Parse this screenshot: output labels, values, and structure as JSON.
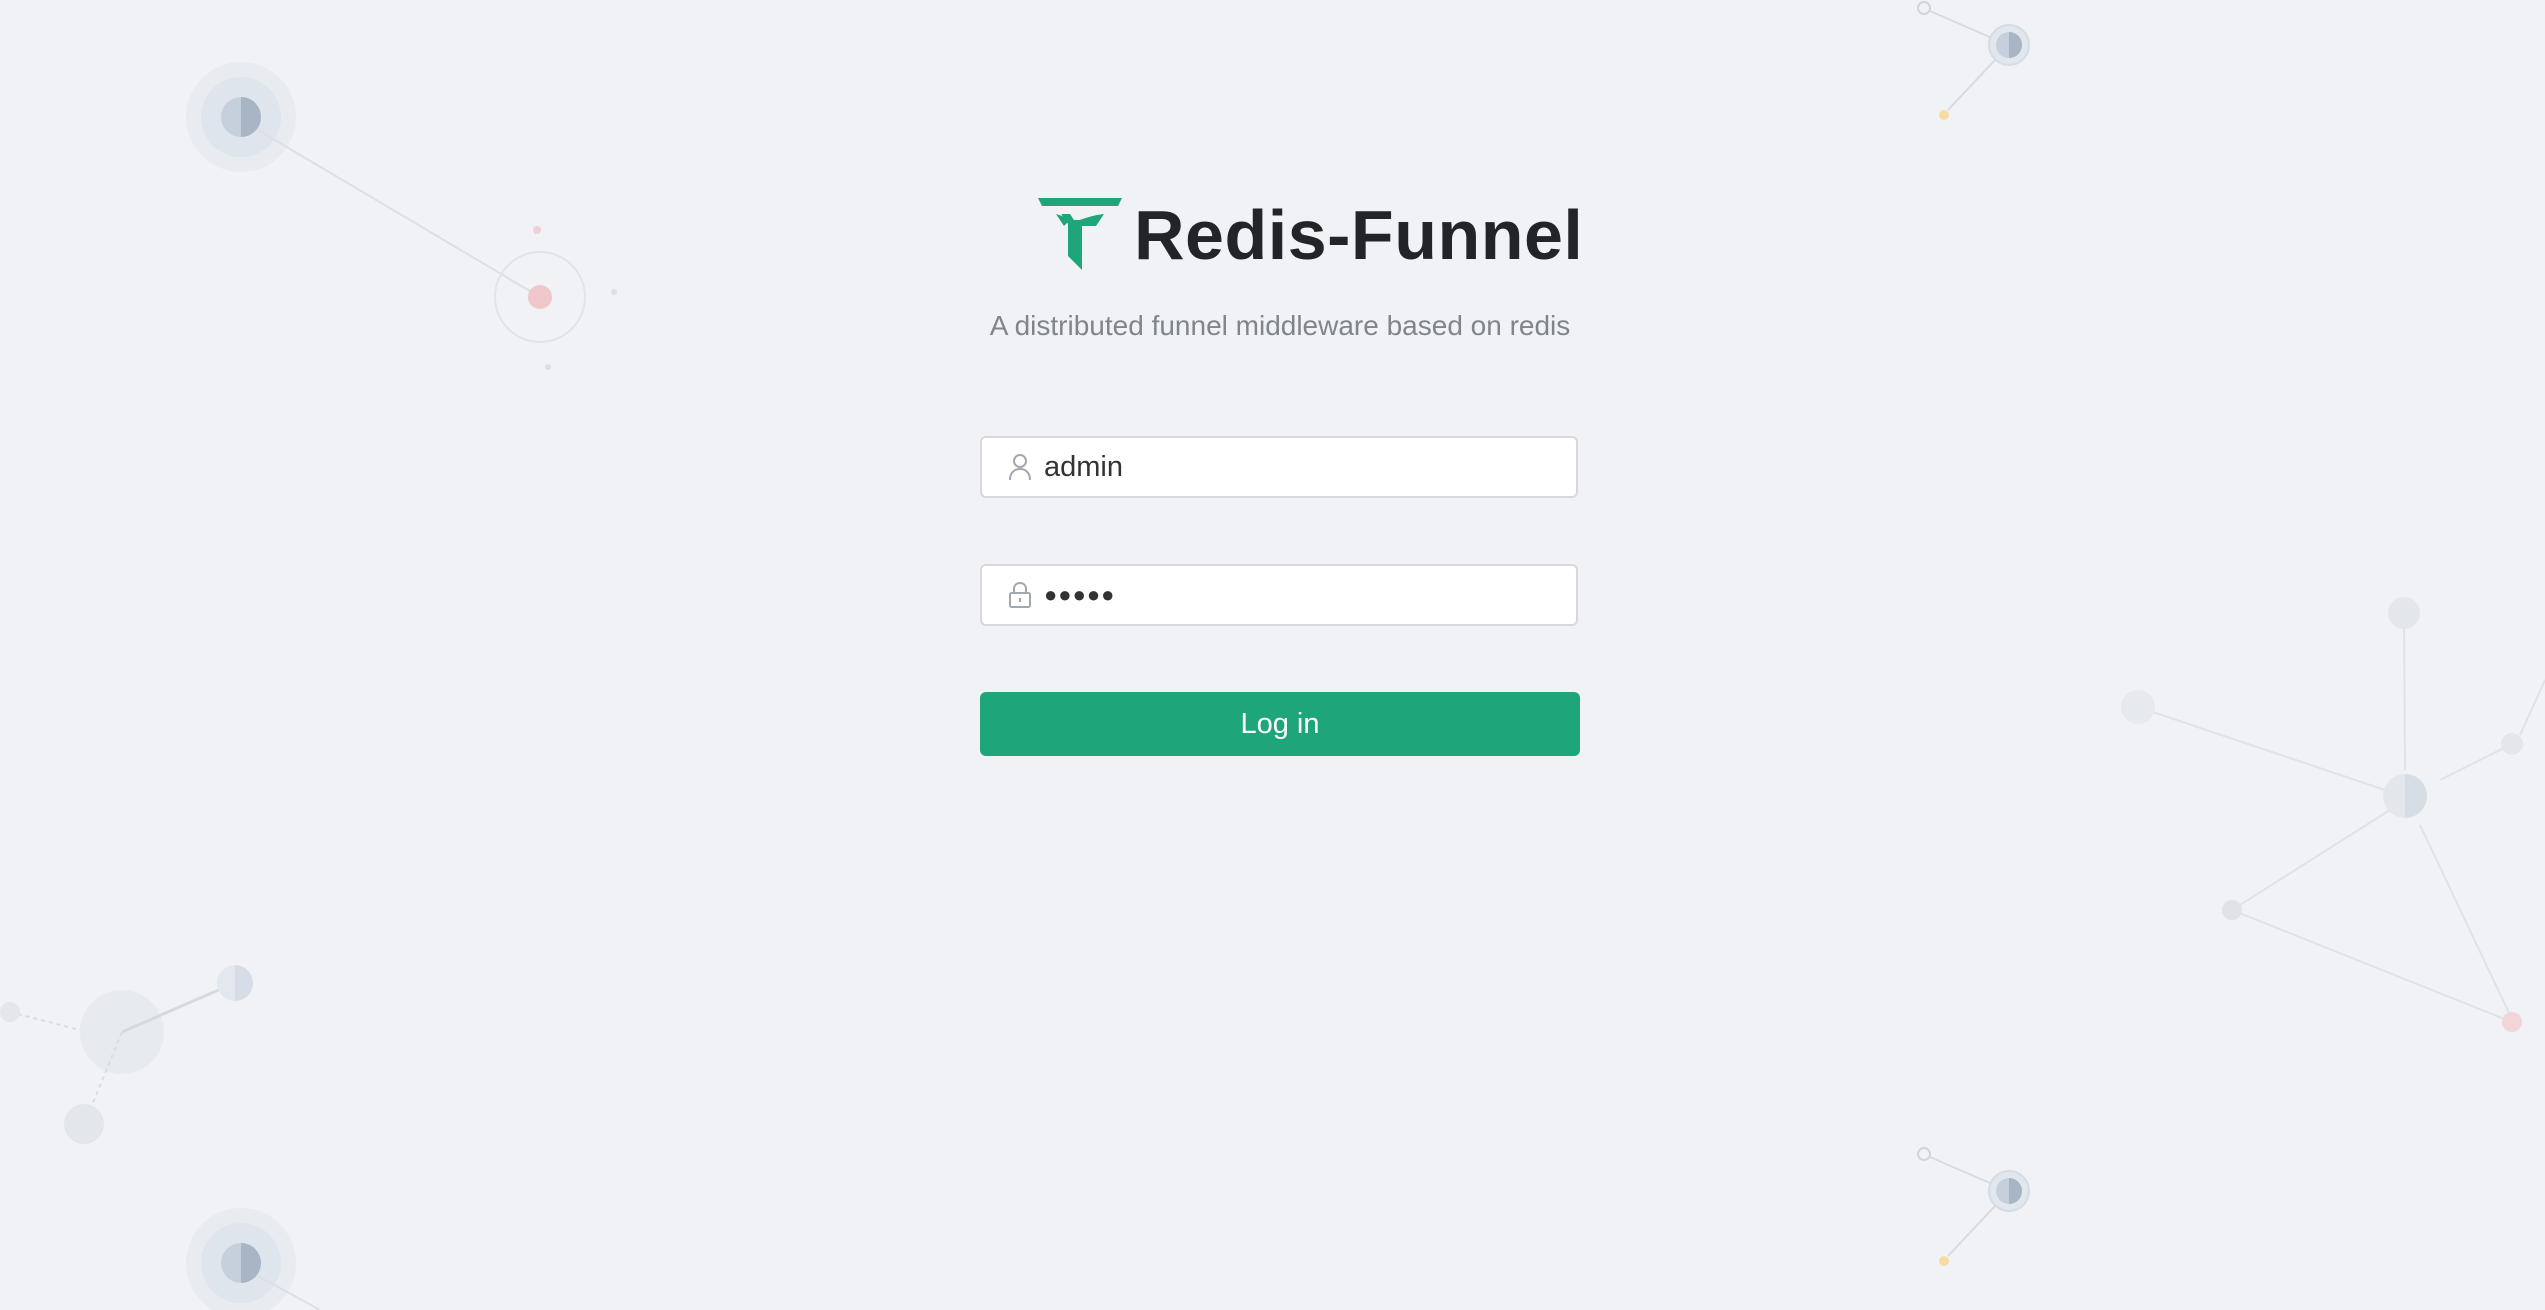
{
  "app": {
    "title": "Redis-Funnel",
    "subtitle": "A distributed funnel middleware based on redis"
  },
  "login_form": {
    "username_value": "admin",
    "password_value": "●●●●●",
    "submit_label": "Log in"
  },
  "icons": {
    "logo": "funnel-logo-icon",
    "username": "user-icon",
    "password": "lock-icon"
  },
  "colors": {
    "accent": "#1ea57a",
    "background": "#f0f2f5",
    "title": "#222428",
    "subtitle": "#80858c"
  }
}
